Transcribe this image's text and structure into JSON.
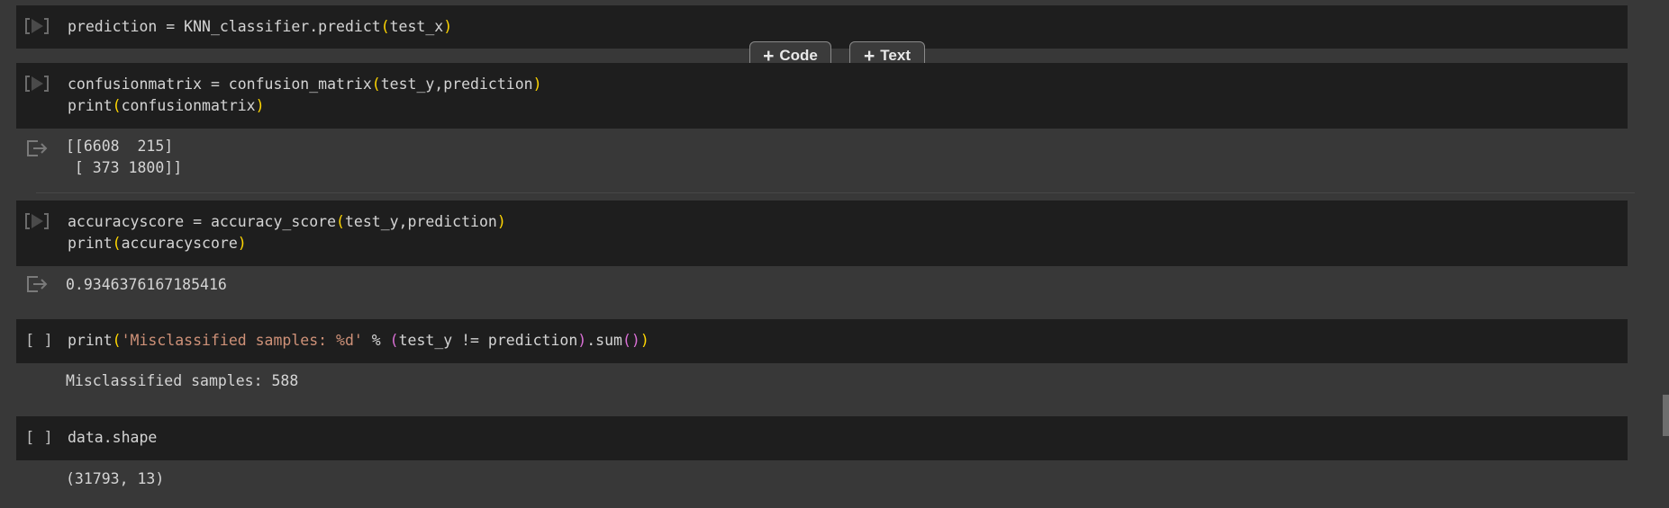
{
  "toolbar": {
    "add_code_label": "Code",
    "add_text_label": "Text"
  },
  "cells": [
    {
      "gutter": "run",
      "lines": [
        [
          {
            "t": "prediction = KNN_classifier.predict"
          },
          {
            "t": "(",
            "c": "y"
          },
          {
            "t": "test_x"
          },
          {
            "t": ")",
            "c": "y"
          }
        ]
      ]
    },
    {
      "gutter": "run",
      "lines": [
        [
          {
            "t": "confusionmatrix = confusion_matrix"
          },
          {
            "t": "(",
            "c": "y"
          },
          {
            "t": "test_y,prediction"
          },
          {
            "t": ")",
            "c": "y"
          }
        ],
        [
          {
            "t": "print"
          },
          {
            "t": "(",
            "c": "y"
          },
          {
            "t": "confusionmatrix"
          },
          {
            "t": ")",
            "c": "y"
          }
        ]
      ],
      "output": "[[6608  215]\n [ 373 1800]]"
    },
    {
      "gutter": "run",
      "lines": [
        [
          {
            "t": "accuracyscore = accuracy_score"
          },
          {
            "t": "(",
            "c": "y"
          },
          {
            "t": "test_y,prediction"
          },
          {
            "t": ")",
            "c": "y"
          }
        ],
        [
          {
            "t": "print"
          },
          {
            "t": "(",
            "c": "y"
          },
          {
            "t": "accuracyscore"
          },
          {
            "t": ")",
            "c": "y"
          }
        ]
      ],
      "output": "0.9346376167185416"
    },
    {
      "gutter": "[ ]",
      "lines": [
        [
          {
            "t": "print"
          },
          {
            "t": "(",
            "c": "y"
          },
          {
            "t": "'Misclassified samples: %d'",
            "c": "str"
          },
          {
            "t": " % "
          },
          {
            "t": "(",
            "c": "p"
          },
          {
            "t": "test_y != prediction"
          },
          {
            "t": ")",
            "c": "p"
          },
          {
            "t": ".sum"
          },
          {
            "t": "()",
            "c": "p"
          },
          {
            "t": ")",
            "c": "y"
          }
        ]
      ],
      "output": "Misclassified samples: 588"
    },
    {
      "gutter": "[ ]",
      "lines": [
        [
          {
            "t": "data.shape"
          }
        ]
      ],
      "output": "(31793, 13)"
    }
  ],
  "icons": {
    "run": "play-icon",
    "output": "output-exit-icon"
  }
}
